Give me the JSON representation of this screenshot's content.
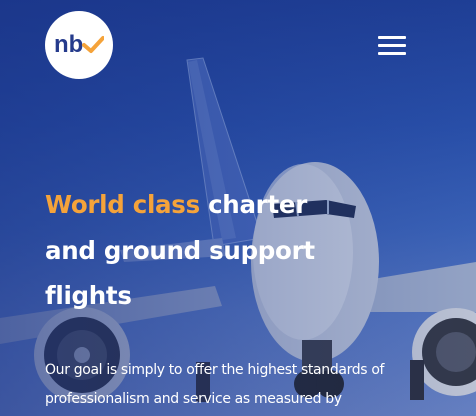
{
  "brand": {
    "logo_text": "nb",
    "accent_color": "#f5a33a"
  },
  "header": {
    "menu_icon": "hamburger-menu-icon"
  },
  "hero": {
    "headline_accent": "World class",
    "headline_rest": " charter and ground support flights",
    "intro": "Our goal is simply to offer the highest standards of professionalism and service as measured by"
  }
}
